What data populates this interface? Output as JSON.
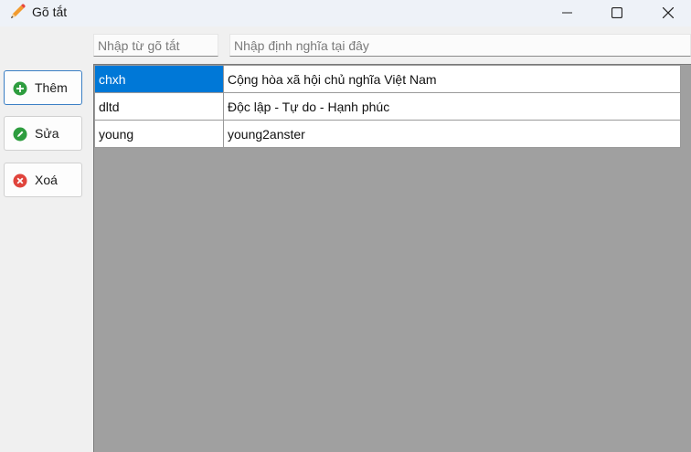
{
  "window": {
    "title": "Gõ tắt",
    "icon": "pencil-icon"
  },
  "inputs": {
    "abbreviation_placeholder": "Nhập từ gõ tắt",
    "definition_placeholder": "Nhập định nghĩa tại đây"
  },
  "sidebar": {
    "add_label": "Thêm",
    "edit_label": "Sửa",
    "delete_label": "Xoá"
  },
  "colors": {
    "add": "#2e9d3f",
    "edit": "#2e9d3f",
    "delete": "#e0443c",
    "selection": "#0078d7"
  },
  "rows": [
    {
      "abbreviation": "chxh",
      "definition": "Cộng hòa xã hội chủ nghĩa Việt Nam"
    },
    {
      "abbreviation": "dltd",
      "definition": "Độc lập - Tự do - Hạnh phúc"
    },
    {
      "abbreviation": "young",
      "definition": "young2anster"
    }
  ]
}
